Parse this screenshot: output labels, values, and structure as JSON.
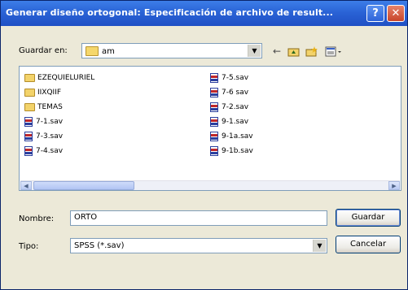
{
  "window": {
    "title": "Generar diseño ortogonal: Especificación de archivo de result...",
    "help_label": "?",
    "close_label": "✕"
  },
  "save_in": {
    "label": "Guardar en:",
    "value": "am"
  },
  "toolbar": {
    "icons": [
      "back-icon",
      "up-folder-icon",
      "new-folder-icon",
      "view-menu-icon"
    ]
  },
  "files": {
    "left_column": [
      {
        "name": "EZEQUIELURIEL",
        "type": "folder"
      },
      {
        "name": "IIXQIIF",
        "type": "folder"
      },
      {
        "name": "TEMAS",
        "type": "folder"
      },
      {
        "name": "7-1.sav",
        "type": "sav"
      },
      {
        "name": "7-3.sav",
        "type": "sav"
      },
      {
        "name": "7-4.sav",
        "type": "sav"
      }
    ],
    "right_column": [
      {
        "name": "7-5.sav",
        "type": "sav"
      },
      {
        "name": "7-6 sav",
        "type": "sav"
      },
      {
        "name": "7-2.sav",
        "type": "sav"
      },
      {
        "name": "9-1.sav",
        "type": "sav"
      },
      {
        "name": "9-1a.sav",
        "type": "sav"
      },
      {
        "name": "9-1b.sav",
        "type": "sav"
      }
    ]
  },
  "name_field": {
    "label": "Nombre:",
    "value": "ORTO"
  },
  "type_field": {
    "label": "Tipo:",
    "value": "SPSS (*.sav)"
  },
  "buttons": {
    "save": "Guardar",
    "cancel": "Cancelar"
  }
}
